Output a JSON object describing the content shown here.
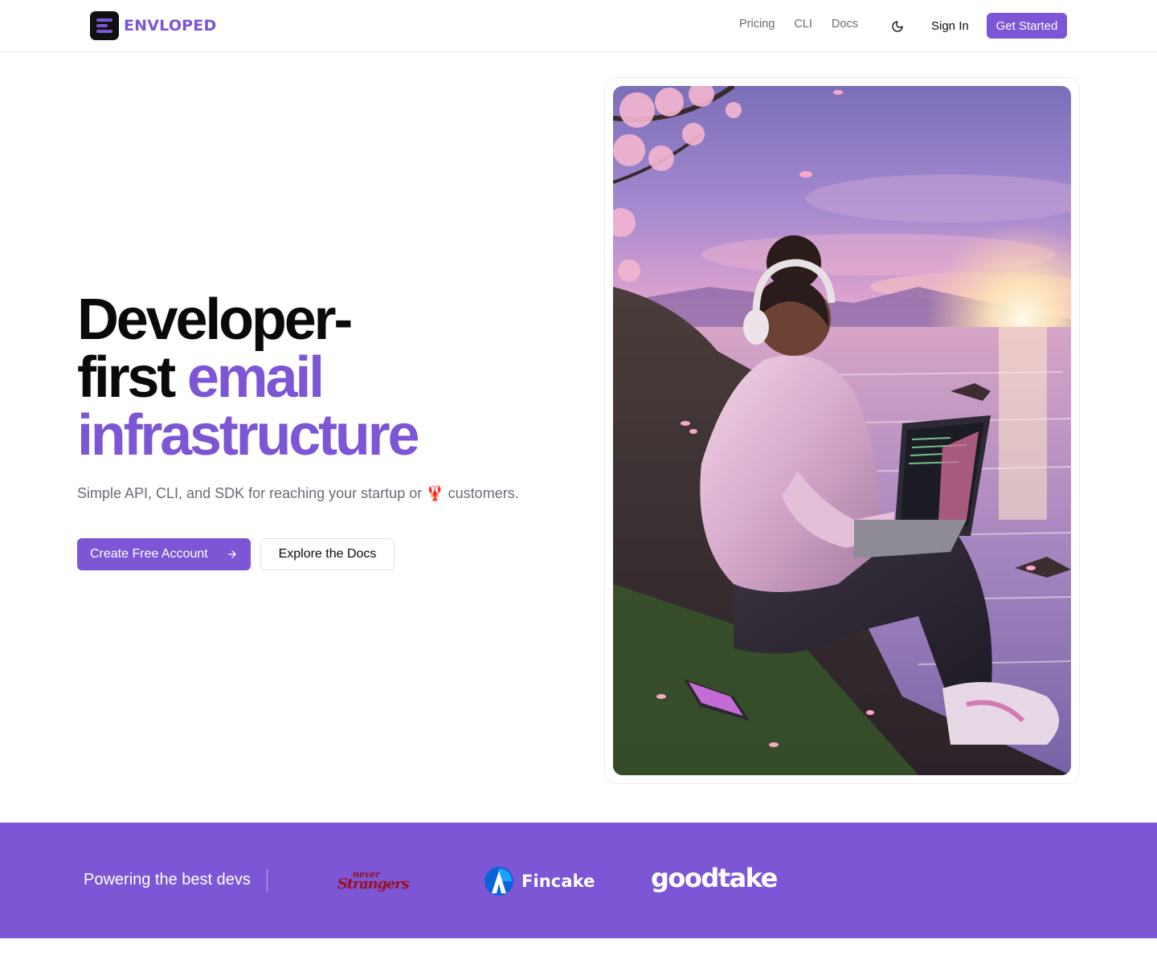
{
  "brand": {
    "name": "ENVLOPED",
    "accent_color": "#7c56d4"
  },
  "nav": {
    "links": [
      "Pricing",
      "CLI",
      "Docs"
    ],
    "theme_toggle_icon": "moon-icon",
    "sign_in_label": "Sign In",
    "get_started_label": "Get Started"
  },
  "hero": {
    "headline_line1": "Developer-",
    "headline_line2_dark": "first",
    "headline_line2_accent": "email",
    "headline_line3_accent": "infrastructure",
    "subhead_before": "Simple API, CLI, and SDK for reaching your startup or",
    "subhead_emoji": "🦞",
    "subhead_after": "customers.",
    "primary_cta_label": "Create Free Account",
    "primary_cta_icon": "arrow-right-icon",
    "secondary_cta_label": "Explore the Docs",
    "image_icon": "hero-illustration"
  },
  "trust": {
    "label": "Powering the best devs",
    "logos": [
      {
        "line1": "never",
        "line2": "Strangers"
      },
      {
        "name": "Fincake"
      },
      {
        "name": "goodtake"
      }
    ]
  }
}
